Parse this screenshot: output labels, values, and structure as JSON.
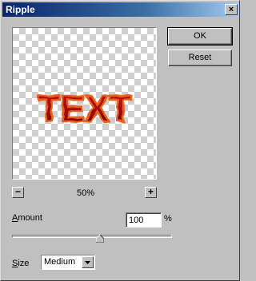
{
  "window": {
    "title": "Ripple",
    "close_label": "×"
  },
  "preview": {
    "text": "TEXT",
    "zoom_level": "50%",
    "zoom_out_label": "−",
    "zoom_in_label": "+"
  },
  "buttons": {
    "ok_label": "OK",
    "reset_label": "Reset"
  },
  "amount": {
    "label_prefix": "A",
    "label_rest": "mount",
    "value": "100",
    "unit": "%",
    "slider_fraction": 0.55
  },
  "size": {
    "label_prefix": "S",
    "label_rest": "ize",
    "selected": "Medium"
  },
  "colors": {
    "titlebar": "#0a246a",
    "face": "#c0c0c0",
    "text_fill": "#b51010",
    "text_stroke": "#e8611a"
  }
}
